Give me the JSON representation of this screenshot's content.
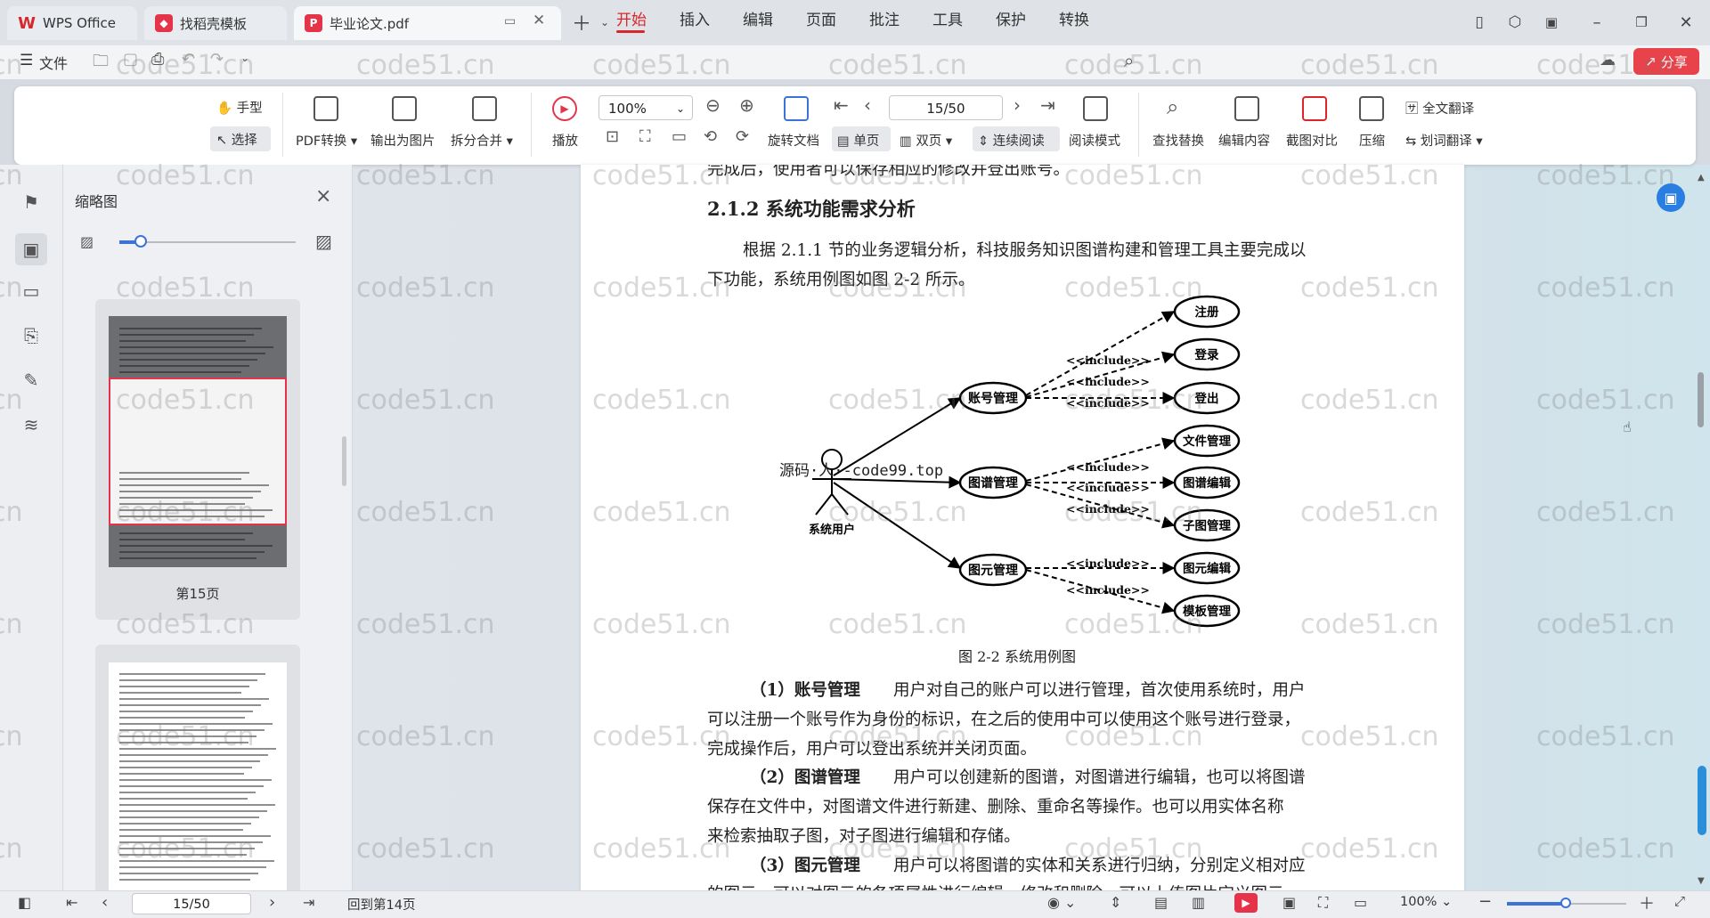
{
  "titlebar": {
    "tabs": [
      {
        "label": "WPS Office",
        "icon": "wps-logo-icon"
      },
      {
        "label": "找稻壳模板",
        "icon": "docer-icon"
      },
      {
        "label": "毕业论文.pdf",
        "icon": "pdf-icon"
      }
    ]
  },
  "menu": {
    "file": "文件",
    "items": [
      "开始",
      "插入",
      "编辑",
      "页面",
      "批注",
      "工具",
      "保护",
      "转换"
    ],
    "share": "分享"
  },
  "ribbon": {
    "hand": "手型",
    "select": "选择",
    "pdf_convert": "PDF转换",
    "export_image": "输出为图片",
    "split_merge": "拆分合并",
    "play": "播放",
    "zoom": "100%",
    "page_indicator": "15/50",
    "rotate": "旋转文档",
    "single": "单页",
    "double": "双页",
    "continuous": "连续阅读",
    "read_mode": "阅读模式",
    "find_replace": "查找替换",
    "edit_content": "编辑内容",
    "screenshot_compare": "截图对比",
    "compress": "压缩",
    "full_translate": "全文翻译",
    "word_translate": "划词翻译"
  },
  "thumbnail_panel": {
    "title": "缩略图",
    "page_label": "第15页"
  },
  "document": {
    "top_cut": "完成后，使用者可以保存相应的修改并登出账号。",
    "heading": "2.1.2 系统功能需求分析",
    "intro_line1": "根据 2.1.1 节的业务逻辑分析，科技服务知识图谱构建和管理工具主要完成以",
    "intro_line2": "下功能，系统用例图如图 2-2 所示。",
    "figure": {
      "actor": "系统用户",
      "overlay": "源码·人·-code99.top",
      "main_cases": [
        "账号管理",
        "图谱管理",
        "图元管理"
      ],
      "sub_cases": [
        "注册",
        "登录",
        "登出",
        "文件管理",
        "图谱编辑",
        "子图管理",
        "图元编辑",
        "模板管理"
      ],
      "include": "<<include>>",
      "caption": "图 2-2  系统用例图"
    },
    "p1_lead": "（1）账号管理",
    "p1_l1": "用户对自己的账户可以进行管理，首次使用系统时，用户",
    "p1_l2": "可以注册一个账号作为身份的标识，在之后的使用中可以使用这个账号进行登录，",
    "p1_l3": "完成操作后，用户可以登出系统并关闭页面。",
    "p2_lead": "（2）图谱管理",
    "p2_l1": "用户可以创建新的图谱，对图谱进行编辑，也可以将图谱",
    "p2_l2": "保存在文件中，对图谱文件进行新建、删除、重命名等操作。也可以用实体名称",
    "p2_l3": "来检索抽取子图，对子图进行编辑和存储。",
    "p3_lead": "（3）图元管理",
    "p3_l1": "用户可以将图谱的实体和关系进行归纳，分别定义相对应",
    "p3_l2": "的图元，可以对图元的各项属性进行编辑、修改和删除，可以上传图片定义图元"
  },
  "watermark": "code51.cn",
  "statusbar": {
    "page": "15/50",
    "back": "回到第14页",
    "zoom": "100%"
  },
  "colors": {
    "accent": "#d9262c",
    "blue": "#3b73d9"
  }
}
